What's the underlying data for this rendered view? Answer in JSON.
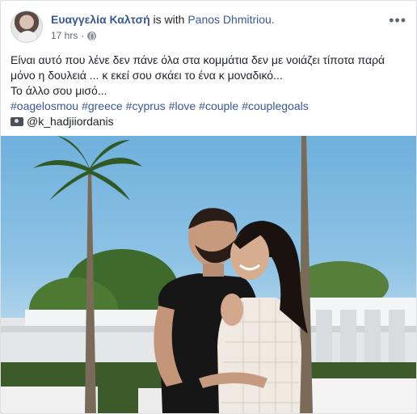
{
  "post": {
    "author": "Ευαγγελία Καλτσή",
    "with_text": "is with",
    "tagged": "Panos Dhmitriou.",
    "time": "17 hrs",
    "separator": "·",
    "more_icon": "•••",
    "lines": [
      "Είναι αυτό που λένε δεν πάνε όλα στα κομμάτια δεν με νοιάζει τίποτα παρά",
      "μόνο η δουλειά ... κ εκεί σου σκάει το ένα κ μοναδικό...",
      "Το άλλο σου μισό..."
    ],
    "hashtags": [
      "#oagelosmou",
      "#greece",
      "#cyprus",
      "#love",
      "#couple",
      "#couplegoals"
    ],
    "photo_credit": "@k_hadjiiordanis"
  },
  "colors": {
    "link": "#385898",
    "text": "#1d2129",
    "meta": "#616770",
    "sky": "#8ec3e5"
  },
  "icons": [
    "globe-icon",
    "more-options-icon",
    "camera-icon"
  ]
}
